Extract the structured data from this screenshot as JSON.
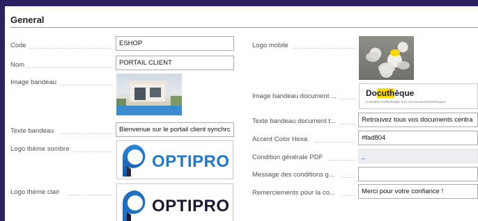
{
  "section": {
    "title": "General"
  },
  "left": {
    "code": {
      "label": "Code",
      "value": "ESHOP"
    },
    "nom": {
      "label": "Nom",
      "value": "PORTAIL CLIENT"
    },
    "image_bandeau": {
      "label": "Image bandeau"
    },
    "texte_bandeau": {
      "label": "Texte bandeau",
      "value": "Bienvenue sur le portail client synchrc"
    },
    "logo_theme_sombre": {
      "label": "Logo thème sombre",
      "logo_text": "OPTIPRO"
    },
    "logo_theme_clair": {
      "label": "Logo thème clair",
      "logo_text": "OPTIPRO"
    }
  },
  "right": {
    "logo_mobile": {
      "label": "Logo mobile"
    },
    "image_bandeau_document": {
      "label": "Image bandeau document ...",
      "logo_text": "Docuthèque",
      "logo_highlight": "cuth",
      "logo_prefix": "Do",
      "logo_suffix": "èque",
      "logo_subtitle": "Consultez et téléchargez tous nos documents techniques."
    },
    "texte_bandeau_document": {
      "label": "Texte bandeau document t...",
      "value": "Retrouvez tous vos documents centra"
    },
    "accent_color_hexa": {
      "label": "Accent Color Hexa",
      "value": "#fad804"
    },
    "condition_generale_pdf": {
      "label": "Condition générale PDF",
      "value": "_"
    },
    "message_conditions": {
      "label": "Message des conditions g...",
      "value": ""
    },
    "remerciements": {
      "label": "Remerciements pour la co...",
      "value": "Merci pour votre confiance !"
    }
  },
  "colors": {
    "accent": "#fad804",
    "logo_blue": "#1f78c8",
    "frame": "#2b2262"
  }
}
